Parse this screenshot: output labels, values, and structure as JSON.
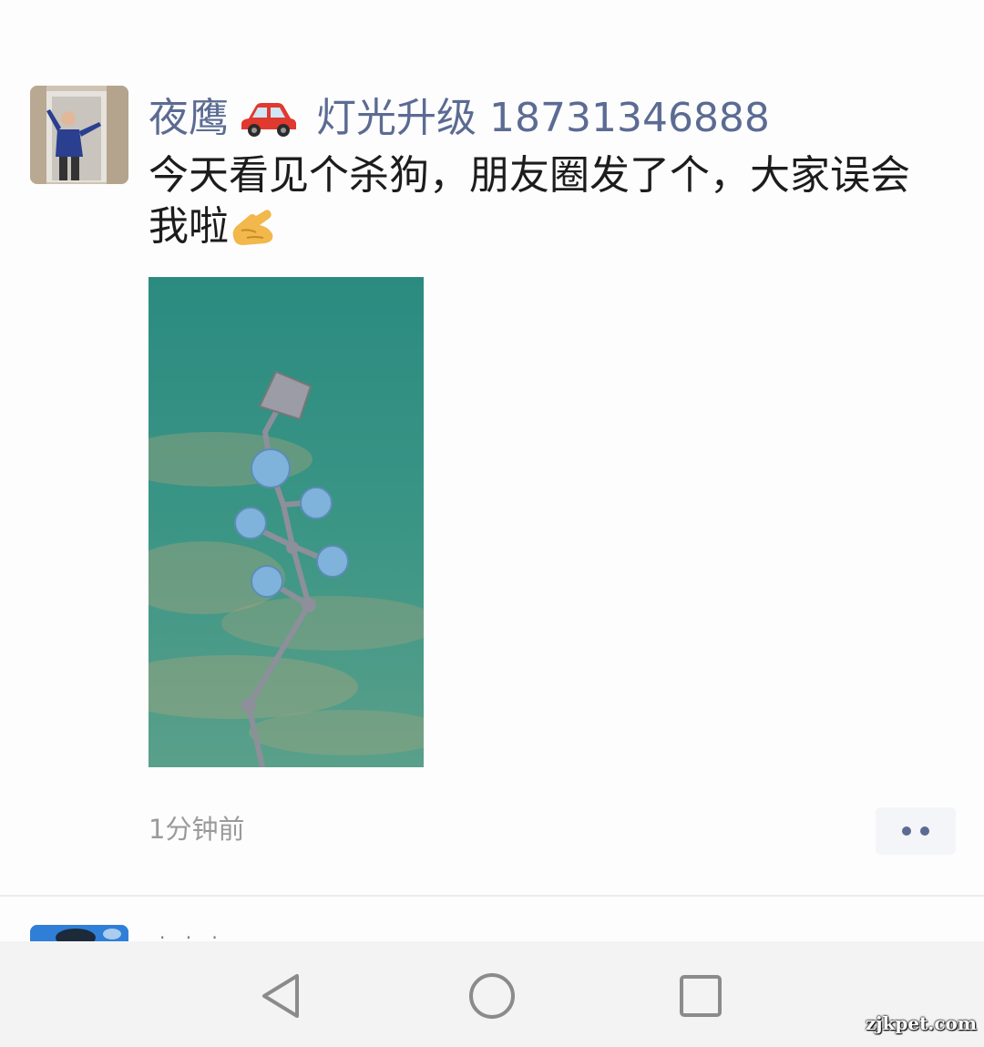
{
  "post": {
    "username": "夜鹰",
    "username_suffix": "灯光升级 18731346888",
    "text": "今天看见个杀狗，朋友圈发了个，大家误会我啦",
    "timestamp": "1分钟前"
  },
  "icons": {
    "car": "red-car-emoji",
    "hand": "ok-hand-emoji",
    "more": "more-dots-icon",
    "back": "back-triangle-icon",
    "home": "home-circle-icon",
    "recents": "recents-square-icon"
  },
  "next_post": {
    "username": "· · · · ·"
  },
  "watermark": "zjkpet.com",
  "colors": {
    "link": "#5b6b93",
    "text": "#1c1c1c",
    "timestamp": "#9a9a9a",
    "water": "#2e8f82",
    "car": "#e0392f"
  }
}
